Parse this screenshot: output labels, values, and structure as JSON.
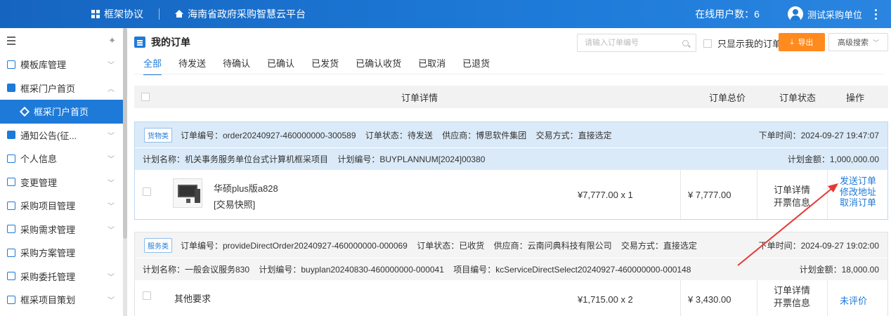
{
  "header": {
    "module": "框架协议",
    "platform": "海南省政府采购智慧云平台",
    "online_users": "在线用户数：6",
    "user": "测试采购单位"
  },
  "sidebar": {
    "items": [
      {
        "label": "模板库管理"
      },
      {
        "label": "框采门户首页"
      },
      {
        "label": "框采门户首页"
      },
      {
        "label": "通知公告(征..."
      },
      {
        "label": "个人信息"
      },
      {
        "label": "变更管理"
      },
      {
        "label": "采购项目管理"
      },
      {
        "label": "采购需求管理"
      },
      {
        "label": "采购方案管理"
      },
      {
        "label": "采购委托管理"
      },
      {
        "label": "框采项目策划"
      }
    ]
  },
  "page": {
    "title": "我的订单",
    "search_placeholder": "请输入订单编号",
    "only_mine": "只显示我的订单",
    "export": "导出",
    "advanced_search": "高级搜索"
  },
  "tabs": [
    "全部",
    "待发送",
    "待确认",
    "已确认",
    "已发货",
    "已确认收货",
    "已取消",
    "已退货"
  ],
  "table_header": {
    "detail": "订单详情",
    "total": "订单总价",
    "status": "订单状态",
    "op": "操作"
  },
  "orders": [
    {
      "badge": "货物类",
      "order_no": "订单编号：order20240927-460000000-300589",
      "order_status": "订单状态：待发送",
      "supplier": "供应商：博思软件集团",
      "trade": "交易方式：直接选定",
      "time": "下单时间：2024-09-27 19:47:07",
      "plan_name": "计划名称：机关事务服务单位台式计算机框采项目",
      "plan_no": "计划编号：BUYPLANNUM[2024]00380",
      "project_no": "",
      "plan_amount": "计划金额：1,000,000.00",
      "product": "华硕plus版a828",
      "snapshot": "[交易快照]",
      "unit_price": "¥7,777.00 x 1",
      "total": "¥ 7,777.00",
      "status_lines": [
        "订单详情",
        "开票信息"
      ],
      "ops": [
        "发送订单",
        "修改地址",
        "取消订单"
      ]
    },
    {
      "badge": "服务类",
      "order_no": "订单编号：provideDirectOrder20240927-460000000-000069",
      "order_status": "订单状态：已收货",
      "supplier": "供应商：云南问典科技有限公司",
      "trade": "交易方式：直接选定",
      "time": "下单时间：2024-09-27 19:02:00",
      "plan_name": "计划名称：一般会议服务830",
      "plan_no": "计划编号：buyplan20240830-460000000-000041",
      "project_no": "项目编号：kcServiceDirectSelect20240927-460000000-000148",
      "plan_amount": "计划金额：18,000.00",
      "product": "其他要求",
      "unit_price": "¥1,715.00 x 2",
      "total": "¥ 3,430.00",
      "status_lines": [
        "订单详情",
        "开票信息"
      ],
      "ops": [
        "未评价"
      ]
    }
  ]
}
